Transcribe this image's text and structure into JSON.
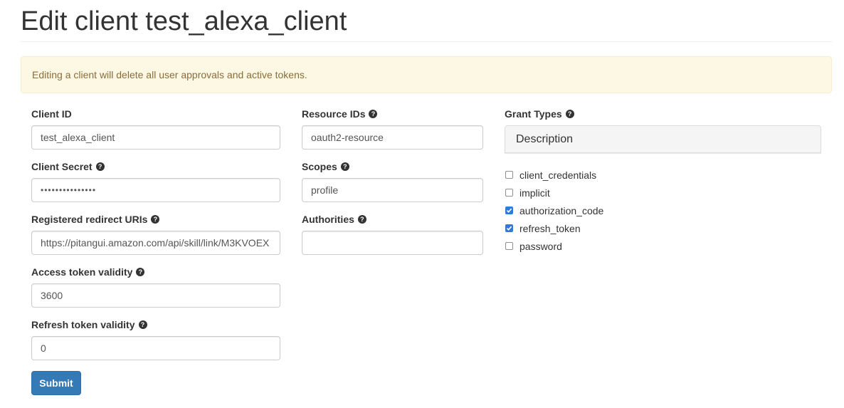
{
  "page": {
    "title": "Edit client test_alexa_client"
  },
  "alert": {
    "text": "Editing a client will delete all user approvals and active tokens."
  },
  "fields": {
    "client_id": {
      "label": "Client ID",
      "value": "test_alexa_client"
    },
    "client_secret": {
      "label": "Client Secret",
      "value": "•••••••••••••••"
    },
    "redirect_uris": {
      "label": "Registered redirect URIs",
      "value": "https://pitangui.amazon.com/api/skill/link/M3KVOEX"
    },
    "access_token_validity": {
      "label": "Access token validity",
      "value": "3600"
    },
    "refresh_token_validity": {
      "label": "Refresh token validity",
      "value": "0"
    },
    "resource_ids": {
      "label": "Resource IDs",
      "value": "oauth2-resource"
    },
    "scopes": {
      "label": "Scopes",
      "value": "profile"
    },
    "authorities": {
      "label": "Authorities",
      "value": ""
    }
  },
  "grant_types": {
    "label": "Grant Types",
    "panel_heading": "Description",
    "options": [
      {
        "label": "client_credentials",
        "checked": false
      },
      {
        "label": "implicit",
        "checked": false
      },
      {
        "label": "authorization_code",
        "checked": true
      },
      {
        "label": "refresh_token",
        "checked": true
      },
      {
        "label": "password",
        "checked": false
      }
    ]
  },
  "submit": {
    "label": "Submit"
  },
  "colors": {
    "primary": "#337ab7",
    "alert_bg": "#fcf8e3",
    "alert_text": "#8a6d3b",
    "checkbox_checked": "#2f7bdb"
  },
  "icons": {
    "help": "question-circle-icon",
    "check": "checkmark-icon"
  }
}
